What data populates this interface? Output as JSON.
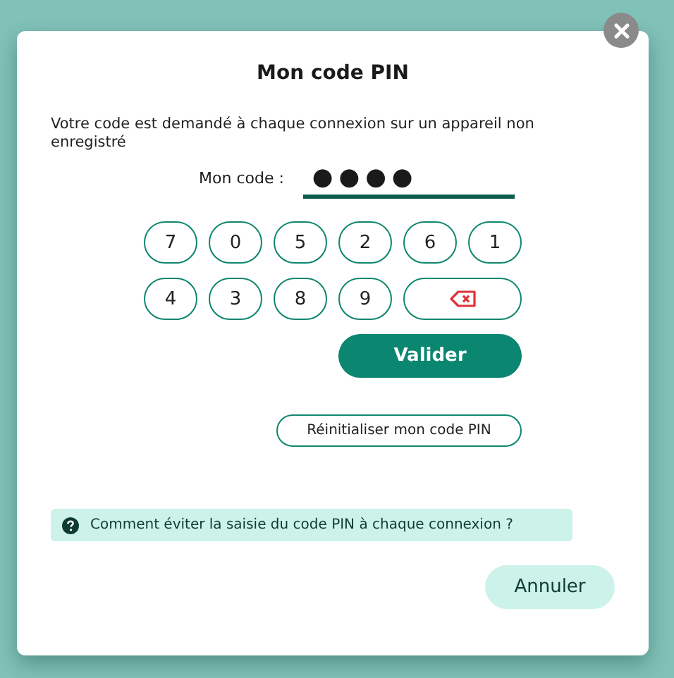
{
  "dialog": {
    "title": "Mon code PIN",
    "description": "Votre code est demandé à chaque connexion sur un appareil non enregistré"
  },
  "pin": {
    "label": "Mon code :",
    "value": "●●●●"
  },
  "keypad": [
    {
      "kind": "digit",
      "label": "7"
    },
    {
      "kind": "digit",
      "label": "0"
    },
    {
      "kind": "digit",
      "label": "5"
    },
    {
      "kind": "digit",
      "label": "2"
    },
    {
      "kind": "digit",
      "label": "6"
    },
    {
      "kind": "digit",
      "label": "1"
    },
    {
      "kind": "digit",
      "label": "4"
    },
    {
      "kind": "digit",
      "label": "3"
    },
    {
      "kind": "digit",
      "label": "8"
    },
    {
      "kind": "digit",
      "label": "9"
    },
    {
      "kind": "backspace"
    }
  ],
  "validate_button": "Valider",
  "reset_button": "Réinitialiser mon code PIN",
  "help_link": "Comment éviter la saisie du code PIN à chaque connexion ?",
  "cancel_button": "Annuler"
}
